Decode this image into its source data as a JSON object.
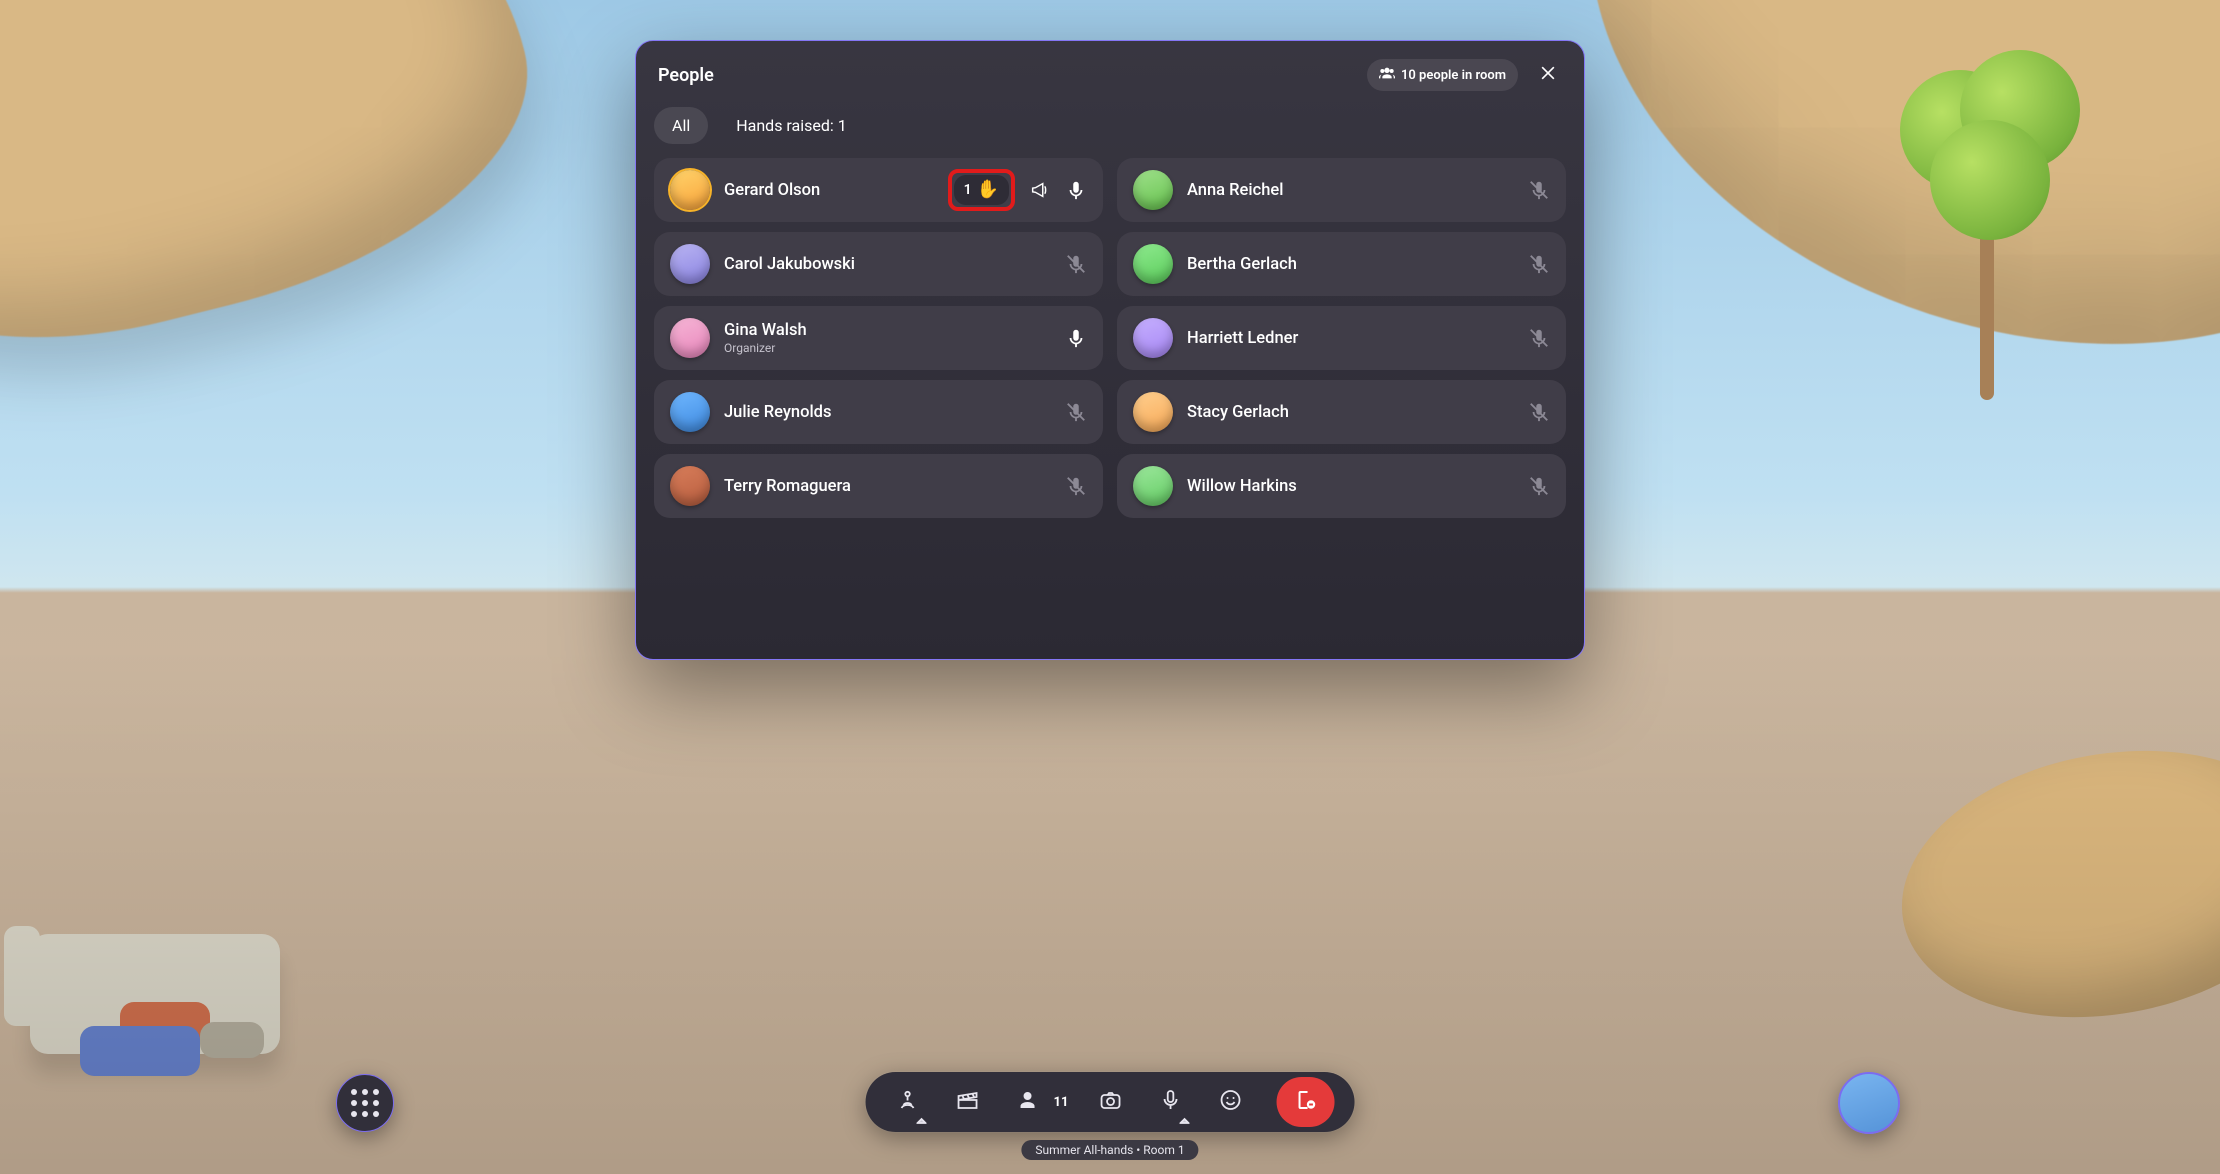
{
  "panel": {
    "title": "People",
    "room_count_label": "10 people in room",
    "tabs": {
      "all": "All",
      "hands": "Hands raised: 1"
    }
  },
  "participants": {
    "left": [
      {
        "name": "Gerard Olson",
        "avatar_bg": "linear-gradient(160deg,#ffd36b,#f9a33a)",
        "ring": true,
        "hand": {
          "order": "1",
          "emoji": "✋"
        },
        "megaphone": true,
        "mic": "on"
      },
      {
        "name": "Carol Jakubowski",
        "avatar_bg": "linear-gradient(160deg,#b9b4f2,#8a83e2)",
        "mic": "muted"
      },
      {
        "name": "Gina Walsh",
        "sub": "Organizer",
        "avatar_bg": "linear-gradient(160deg,#f6b6d6,#e885bb)",
        "mic": "on"
      },
      {
        "name": "Julie Reynolds",
        "avatar_bg": "linear-gradient(160deg,#6fb7ff,#3f8ae0)",
        "mic": "muted"
      },
      {
        "name": "Terry Romaguera",
        "avatar_bg": "linear-gradient(160deg,#d77d5a,#b95e3f)",
        "mic": "muted"
      }
    ],
    "right": [
      {
        "name": "Anna Reichel",
        "avatar_bg": "linear-gradient(160deg,#9fe08b,#66c34e)",
        "mic": "muted"
      },
      {
        "name": "Bertha Gerlach",
        "avatar_bg": "linear-gradient(160deg,#8ee98e,#5bcd5b)",
        "mic": "muted"
      },
      {
        "name": "Harriett Ledner",
        "avatar_bg": "linear-gradient(160deg,#c6b0ff,#a686f3)",
        "mic": "muted"
      },
      {
        "name": "Stacy Gerlach",
        "avatar_bg": "linear-gradient(160deg,#ffcf8e,#f7a957)",
        "mic": "muted"
      },
      {
        "name": "Willow Harkins",
        "avatar_bg": "linear-gradient(160deg,#9ce79c,#63cc63)",
        "mic": "muted"
      }
    ]
  },
  "dock": {
    "people_count": "11"
  },
  "room_label": "Summer All-hands • Room 1",
  "self_avatar_bg": "linear-gradient(160deg,#79b5f0,#5593d8)"
}
